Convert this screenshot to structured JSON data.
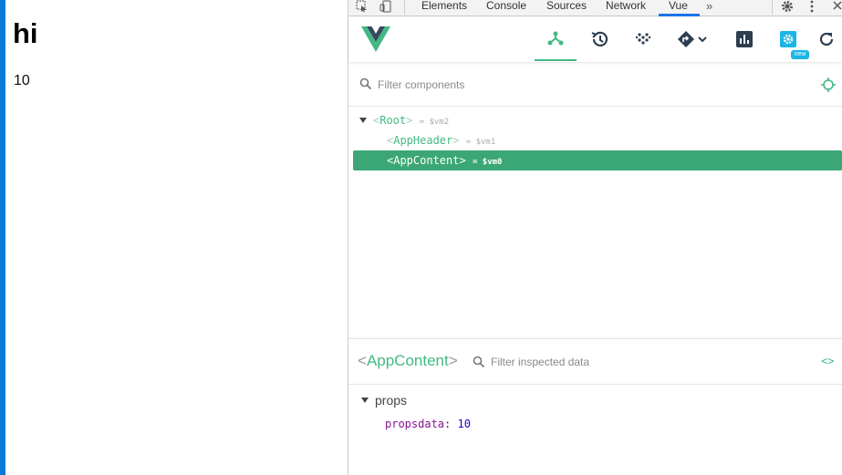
{
  "page": {
    "heading": "hi",
    "value_text": "10"
  },
  "devtools": {
    "tabs": [
      "Elements",
      "Console",
      "Sources",
      "Network",
      "Vue"
    ],
    "active_tab": "Vue",
    "more_tabs_icon": "chevron-double-right-icon",
    "vue_toolbar": {
      "icons": [
        "components-icon",
        "timeline-icon",
        "vuex-icon",
        "router-icon",
        "performance-icon",
        "settings-icon",
        "refresh-icon"
      ],
      "new_badge": "new",
      "accent": "#42b983"
    },
    "filter_components_placeholder": "Filter components",
    "tree": [
      {
        "name": "Root",
        "ref": "= $vm2",
        "expanded": true,
        "selected": false,
        "depth": 0
      },
      {
        "name": "AppHeader",
        "ref": "= $vm1",
        "selected": false,
        "depth": 1
      },
      {
        "name": "AppContent",
        "ref": "= $vm0",
        "selected": true,
        "depth": 1
      }
    ],
    "inspector": {
      "component_name": "AppContent",
      "filter_placeholder": "Filter inspected data",
      "section": "props",
      "props": [
        {
          "key": "propsdata",
          "value": "10"
        }
      ]
    },
    "colors": {
      "selected_row": "#3ba776",
      "vue_green": "#42b983"
    }
  }
}
